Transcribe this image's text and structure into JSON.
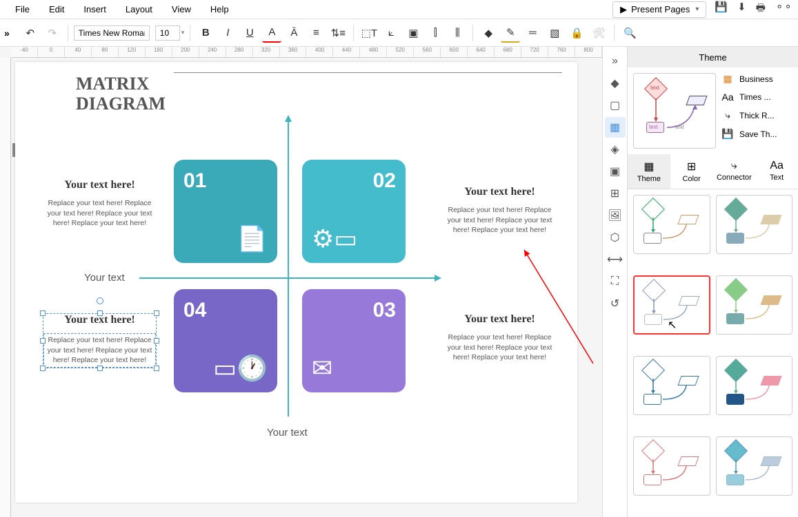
{
  "menubar": {
    "items": [
      "File",
      "Edit",
      "Insert",
      "Layout",
      "View",
      "Help"
    ],
    "present": "Present Pages"
  },
  "toolbar": {
    "font": "Times New Roman",
    "size": "10"
  },
  "diagram": {
    "title_line1": "MATRIX",
    "title_line2": "DIAGRAM",
    "axis_x": "Your text",
    "axis_y": "Your text",
    "quads": [
      {
        "num": "01"
      },
      {
        "num": "02"
      },
      {
        "num": "03"
      },
      {
        "num": "04"
      }
    ],
    "textblocks": [
      {
        "hdr": "Your text here!",
        "body": "Replace your text here!   Replace your text here!   Replace your text here!   Replace your text here!"
      },
      {
        "hdr": "Your text here!",
        "body": "Replace your text here!   Replace your text here!   Replace your text here!   Replace your text here!"
      },
      {
        "hdr": "Your text here!",
        "body": "Replace your text here!   Replace your text here!   Replace your text here!   Replace your text here!"
      },
      {
        "hdr": "Your text here!",
        "body": "Replace your text here!   Replace your text here!   Replace your text here!   Replace your text here!"
      }
    ]
  },
  "theme_panel": {
    "title": "Theme",
    "options": {
      "business": "Business",
      "font": "Times ...",
      "connector": "Thick R...",
      "save": "Save Th..."
    },
    "tabs": {
      "theme": "Theme",
      "color": "Color",
      "connector": "Connector",
      "text": "Text"
    },
    "preview_text": "text"
  },
  "ruler_marks": [
    "-40",
    "0",
    "40",
    "80",
    "120",
    "160",
    "200",
    "240",
    "280",
    "320",
    "360",
    "400",
    "440",
    "480",
    "520",
    "560",
    "600",
    "640",
    "680",
    "720",
    "760",
    "800"
  ]
}
